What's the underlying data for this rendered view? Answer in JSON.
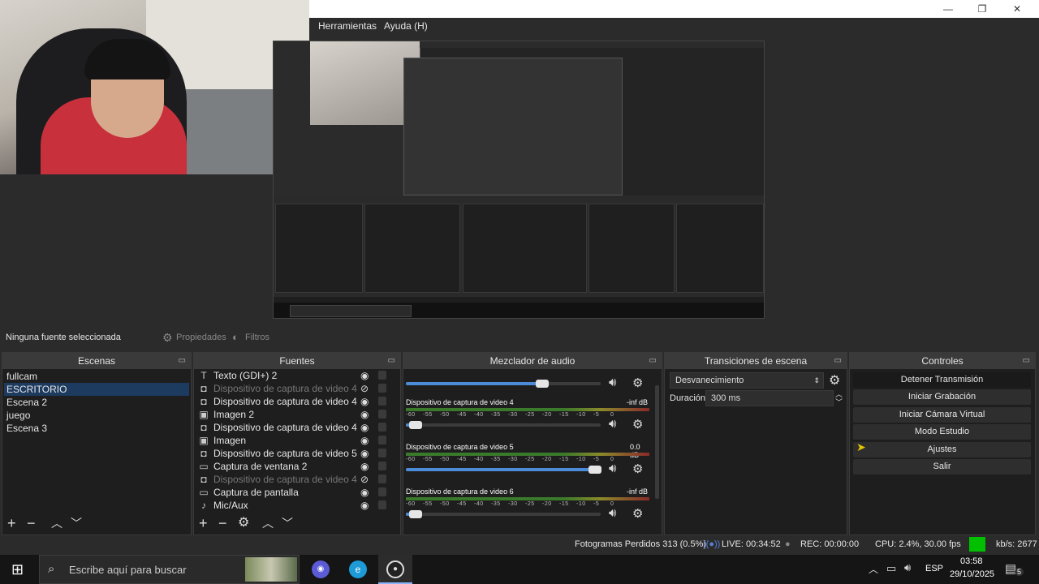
{
  "window": {
    "minimize": "—",
    "restore": "❐",
    "close": "✕"
  },
  "menu": {
    "tools": "Herramientas",
    "help": "Ayuda (H)"
  },
  "source_bar": {
    "no_source": "Ninguna fuente seleccionada",
    "properties": "Propiedades",
    "filters": "Filtros"
  },
  "scenes": {
    "title": "Escenas",
    "items": [
      "fullcam",
      "ESCRITORIO",
      "Escena 2",
      "juego",
      "Escena 3"
    ],
    "selected": "ESCRITORIO"
  },
  "sources": {
    "title": "Fuentes",
    "items": [
      {
        "label": "Texto (GDI+) 2",
        "icon": "text-icon",
        "glyph": "T",
        "dim": false
      },
      {
        "label": "Dispositivo de captura de video 4",
        "icon": "camera-icon",
        "glyph": "◘",
        "dim": true
      },
      {
        "label": "Dispositivo de captura de video 4",
        "icon": "camera-icon",
        "glyph": "◘",
        "dim": false
      },
      {
        "label": "Imagen 2",
        "icon": "image-icon",
        "glyph": "▣",
        "dim": false
      },
      {
        "label": "Dispositivo de captura de video 4",
        "icon": "camera-icon",
        "glyph": "◘",
        "dim": false
      },
      {
        "label": "Imagen",
        "icon": "image-icon",
        "glyph": "▣",
        "dim": false
      },
      {
        "label": "Dispositivo de captura de video 5",
        "icon": "camera-icon",
        "glyph": "◘",
        "dim": false
      },
      {
        "label": "Captura de ventana 2",
        "icon": "window-icon",
        "glyph": "▭",
        "dim": false
      },
      {
        "label": "Dispositivo de captura de video 4",
        "icon": "camera-icon",
        "glyph": "◘",
        "dim": true
      },
      {
        "label": "Captura de pantalla",
        "icon": "monitor-icon",
        "glyph": "▭",
        "dim": false
      },
      {
        "label": "Mic/Aux",
        "icon": "microphone-icon",
        "glyph": "♪",
        "dim": false
      }
    ]
  },
  "mixer": {
    "title": "Mezclador de audio",
    "top_volume": 0.7,
    "tracks": [
      {
        "name": "Dispositivo de captura de video 4",
        "db": "-inf dB",
        "volume": 0.05
      },
      {
        "name": "Dispositivo de captura de video 5",
        "db": "0.0 dB",
        "volume": 0.97
      },
      {
        "name": "Dispositivo de captura de video 6",
        "db": "-inf dB",
        "volume": 0.05
      }
    ],
    "ticks": [
      "-60",
      "-55",
      "-50",
      "-45",
      "-40",
      "-35",
      "-30",
      "-25",
      "-20",
      "-15",
      "-10",
      "-5",
      "0"
    ]
  },
  "transitions": {
    "title": "Transiciones de escena",
    "selected": "Desvanecimiento",
    "duration_label": "Duración",
    "duration_value": "300 ms"
  },
  "controls": {
    "title": "Controles",
    "buttons": [
      "Detener Transmisión",
      "Iniciar Grabación",
      "Iniciar Cámara Virtual",
      "Modo Estudio",
      "Ajustes",
      "Salir"
    ]
  },
  "status": {
    "dropped": "Fotogramas Perdidos 313 (0.5%)",
    "live": "LIVE: 00:34:52",
    "rec": "REC: 00:00:00",
    "cpu": "CPU: 2.4%, 30.00 fps",
    "kbs": "kb/s: 2677",
    "live_color": "#00c000"
  },
  "taskbar": {
    "search_placeholder": "Escribe aquí para buscar",
    "lang": "ESP",
    "time": "03:58",
    "date": "29/10/2025",
    "notifications": "5"
  }
}
